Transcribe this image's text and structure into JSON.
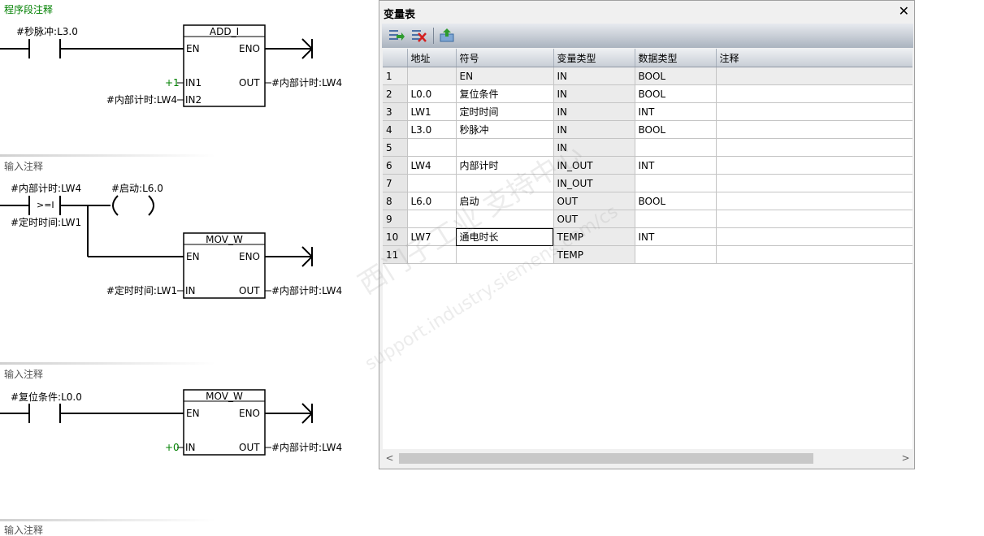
{
  "ladder": {
    "program_comment": "程序段注释",
    "input_comment": "输入注释",
    "network1": {
      "contact_label": "#秒脉冲:L3.0",
      "block_title": "ADD_I",
      "en": "EN",
      "eno": "ENO",
      "in1_const": "+1",
      "in1": "IN1",
      "in2_operand": "#内部计时:LW4",
      "in2": "IN2",
      "out": "OUT",
      "out_operand": "#内部计时:LW4"
    },
    "network2": {
      "compare_top": "#内部计时:LW4",
      "compare_op": ">=I",
      "compare_bottom": "#定时时间:LW1",
      "coil_label": "#启动:L6.0",
      "block_title": "MOV_W",
      "en": "EN",
      "eno": "ENO",
      "in_operand": "#定时时间:LW1",
      "in": "IN",
      "out": "OUT",
      "out_operand": "#内部计时:LW4"
    },
    "network3": {
      "contact_label": "#复位条件:L0.0",
      "block_title": "MOV_W",
      "en": "EN",
      "eno": "ENO",
      "in_const": "+0",
      "in": "IN",
      "out": "OUT",
      "out_operand": "#内部计时:LW4"
    }
  },
  "var_table": {
    "title": "变量表",
    "close": "✕",
    "columns": [
      "",
      "地址",
      "符号",
      "变量类型",
      "数据类型",
      "注释"
    ],
    "rows": [
      [
        "1",
        "",
        "EN",
        "IN",
        "BOOL",
        ""
      ],
      [
        "2",
        "L0.0",
        "复位条件",
        "IN",
        "BOOL",
        ""
      ],
      [
        "3",
        "LW1",
        "定时时间",
        "IN",
        "INT",
        ""
      ],
      [
        "4",
        "L3.0",
        "秒脉冲",
        "IN",
        "BOOL",
        ""
      ],
      [
        "5",
        "",
        "",
        "IN",
        "",
        ""
      ],
      [
        "6",
        "LW4",
        "内部计时",
        "IN_OUT",
        "INT",
        ""
      ],
      [
        "7",
        "",
        "",
        "IN_OUT",
        "",
        ""
      ],
      [
        "8",
        "L6.0",
        "启动",
        "OUT",
        "BOOL",
        ""
      ],
      [
        "9",
        "",
        "",
        "OUT",
        "",
        ""
      ],
      [
        "10",
        "LW7",
        "通电时长",
        "TEMP",
        "INT",
        ""
      ],
      [
        "11",
        "",
        "",
        "TEMP",
        "",
        ""
      ]
    ],
    "scroll_left": "<",
    "scroll_right": ">"
  },
  "watermark": {
    "line1": "西门子工业  支持中心",
    "line2": "support.industry.siemens.com/cs"
  },
  "colors": {
    "constant": "#008000",
    "comment_title": "#008000",
    "toolbar_top": "#e7eaef",
    "toolbar_bottom": "#aab3bf"
  },
  "icons": [
    "insert-row-icon",
    "delete-row-icon",
    "download-icon"
  ]
}
